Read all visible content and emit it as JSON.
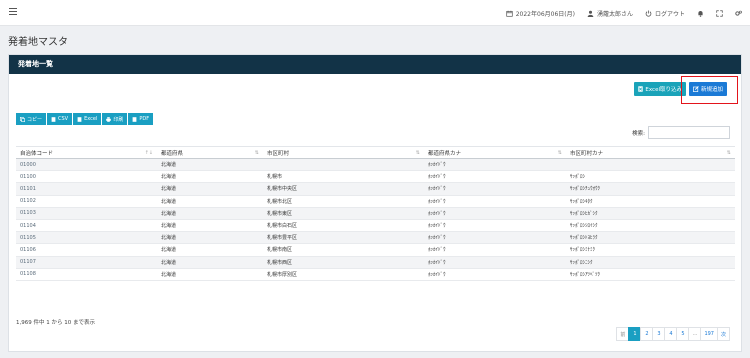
{
  "topnav": {
    "date": "2022年06月06日(月)",
    "user": "湧蘿太郎さん",
    "logout": "ログアウト"
  },
  "page_title": "発着地マスタ",
  "card": {
    "header": "発着地一覧",
    "excel_import": "Excel取り込み",
    "new_button": "新規追加"
  },
  "export_buttons": [
    "コピー",
    "CSV",
    "Excel",
    "印刷",
    "PDF"
  ],
  "search": {
    "label": "検索:",
    "value": ""
  },
  "table": {
    "headers": [
      "自治体コード",
      "都道府県",
      "市区町村",
      "都道府県カナ",
      "市区町村カナ"
    ],
    "rows": [
      [
        "01000",
        "北海道",
        "",
        "ﾎｯｶｲﾄﾞｳ",
        ""
      ],
      [
        "01100",
        "北海道",
        "札幌市",
        "ﾎｯｶｲﾄﾞｳ",
        "ｻｯﾎﾟﾛｼ"
      ],
      [
        "01101",
        "北海道",
        "札幌市中央区",
        "ﾎｯｶｲﾄﾞｳ",
        "ｻｯﾎﾟﾛｼﾁｭｳｵｳｸ"
      ],
      [
        "01102",
        "北海道",
        "札幌市北区",
        "ﾎｯｶｲﾄﾞｳ",
        "ｻｯﾎﾟﾛｼｷﾀｸ"
      ],
      [
        "01103",
        "北海道",
        "札幌市東区",
        "ﾎｯｶｲﾄﾞｳ",
        "ｻｯﾎﾟﾛｼﾋｶﾞｼｸ"
      ],
      [
        "01104",
        "北海道",
        "札幌市白石区",
        "ﾎｯｶｲﾄﾞｳ",
        "ｻｯﾎﾟﾛｼｼﾛｲｼｸ"
      ],
      [
        "01105",
        "北海道",
        "札幌市豊平区",
        "ﾎｯｶｲﾄﾞｳ",
        "ｻｯﾎﾟﾛｼﾄﾖﾋﾗｸ"
      ],
      [
        "01106",
        "北海道",
        "札幌市南区",
        "ﾎｯｶｲﾄﾞｳ",
        "ｻｯﾎﾟﾛｼﾐﾅﾐｸ"
      ],
      [
        "01107",
        "北海道",
        "札幌市西区",
        "ﾎｯｶｲﾄﾞｳ",
        "ｻｯﾎﾟﾛｼﾆｼｸ"
      ],
      [
        "01108",
        "北海道",
        "札幌市厚別区",
        "ﾎｯｶｲﾄﾞｳ",
        "ｻｯﾎﾟﾛｼｱﾂﾍﾞﾂｸ"
      ]
    ]
  },
  "info": "1,969 件中 1 から 10 まで表示",
  "pager": [
    "前",
    "1",
    "2",
    "3",
    "4",
    "5",
    "…",
    "197",
    "次"
  ],
  "colors": {
    "header_bg": "#123347",
    "accent": "#1a9fc2",
    "primary": "#1b7ad6",
    "highlight": "#e3141b"
  }
}
